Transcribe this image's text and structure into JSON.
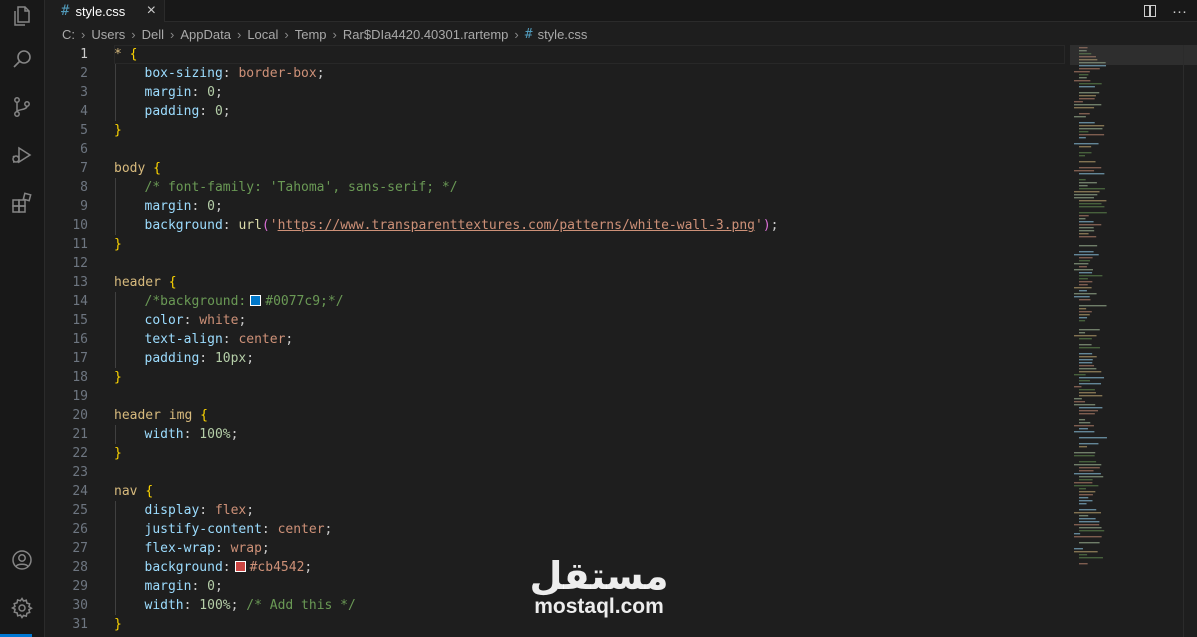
{
  "tab": {
    "label": "style.css",
    "icon": "css-file-icon",
    "close": "×"
  },
  "breadcrumb": {
    "items": [
      "C:",
      "Users",
      "Dell",
      "AppData",
      "Local",
      "Temp",
      "Rar$DIa4420.40301.rartemp",
      "style.css"
    ],
    "separator": "›"
  },
  "editor": {
    "active_line": 1,
    "lines": [
      {
        "n": "1",
        "indent": 0,
        "t": [
          [
            "sel",
            "* "
          ],
          [
            "brace",
            "{"
          ]
        ]
      },
      {
        "n": "2",
        "indent": 1,
        "t": [
          [
            "prop",
            "box-sizing"
          ],
          [
            "punc",
            ": "
          ],
          [
            "val",
            "border-box"
          ],
          [
            "punc",
            ";"
          ]
        ]
      },
      {
        "n": "3",
        "indent": 1,
        "t": [
          [
            "prop",
            "margin"
          ],
          [
            "punc",
            ": "
          ],
          [
            "num",
            "0"
          ],
          [
            "punc",
            ";"
          ]
        ]
      },
      {
        "n": "4",
        "indent": 1,
        "t": [
          [
            "prop",
            "padding"
          ],
          [
            "punc",
            ": "
          ],
          [
            "num",
            "0"
          ],
          [
            "punc",
            ";"
          ]
        ]
      },
      {
        "n": "5",
        "indent": 0,
        "t": [
          [
            "brace",
            "}"
          ]
        ]
      },
      {
        "n": "6",
        "indent": 0,
        "t": []
      },
      {
        "n": "7",
        "indent": 0,
        "t": [
          [
            "sel",
            "body "
          ],
          [
            "brace",
            "{"
          ]
        ]
      },
      {
        "n": "8",
        "indent": 1,
        "t": [
          [
            "comment",
            "/* font-family: 'Tahoma', sans-serif; */"
          ]
        ]
      },
      {
        "n": "9",
        "indent": 1,
        "t": [
          [
            "prop",
            "margin"
          ],
          [
            "punc",
            ": "
          ],
          [
            "num",
            "0"
          ],
          [
            "punc",
            ";"
          ]
        ]
      },
      {
        "n": "10",
        "indent": 1,
        "t": [
          [
            "prop",
            "background"
          ],
          [
            "punc",
            ": "
          ],
          [
            "func",
            "url"
          ],
          [
            "paren",
            "("
          ],
          [
            "val",
            "'"
          ],
          [
            "url",
            "https://www.transparenttextures.com/patterns/white-wall-3.png"
          ],
          [
            "val",
            "'"
          ],
          [
            "paren",
            ")"
          ],
          [
            "punc",
            ";"
          ]
        ]
      },
      {
        "n": "11",
        "indent": 0,
        "t": [
          [
            "brace",
            "}"
          ]
        ]
      },
      {
        "n": "12",
        "indent": 0,
        "t": []
      },
      {
        "n": "13",
        "indent": 0,
        "t": [
          [
            "sel",
            "header "
          ],
          [
            "brace",
            "{"
          ]
        ]
      },
      {
        "n": "14",
        "indent": 1,
        "t": [
          [
            "comment",
            "/*background:"
          ],
          [
            "swatch",
            "#0077c9"
          ],
          [
            "comment",
            "#0077c9;*/"
          ]
        ]
      },
      {
        "n": "15",
        "indent": 1,
        "t": [
          [
            "prop",
            "color"
          ],
          [
            "punc",
            ": "
          ],
          [
            "val",
            "white"
          ],
          [
            "punc",
            ";"
          ]
        ]
      },
      {
        "n": "16",
        "indent": 1,
        "t": [
          [
            "prop",
            "text-align"
          ],
          [
            "punc",
            ": "
          ],
          [
            "val",
            "center"
          ],
          [
            "punc",
            ";"
          ]
        ]
      },
      {
        "n": "17",
        "indent": 1,
        "t": [
          [
            "prop",
            "padding"
          ],
          [
            "punc",
            ": "
          ],
          [
            "num",
            "10px"
          ],
          [
            "punc",
            ";"
          ]
        ]
      },
      {
        "n": "18",
        "indent": 0,
        "t": [
          [
            "brace",
            "}"
          ]
        ]
      },
      {
        "n": "19",
        "indent": 0,
        "t": []
      },
      {
        "n": "20",
        "indent": 0,
        "t": [
          [
            "sel",
            "header img "
          ],
          [
            "brace",
            "{"
          ]
        ]
      },
      {
        "n": "21",
        "indent": 1,
        "t": [
          [
            "prop",
            "width"
          ],
          [
            "punc",
            ": "
          ],
          [
            "num",
            "100%"
          ],
          [
            "punc",
            ";"
          ]
        ]
      },
      {
        "n": "22",
        "indent": 0,
        "t": [
          [
            "brace",
            "}"
          ]
        ]
      },
      {
        "n": "23",
        "indent": 0,
        "t": []
      },
      {
        "n": "24",
        "indent": 0,
        "t": [
          [
            "sel",
            "nav "
          ],
          [
            "brace",
            "{"
          ]
        ]
      },
      {
        "n": "25",
        "indent": 1,
        "t": [
          [
            "prop",
            "display"
          ],
          [
            "punc",
            ": "
          ],
          [
            "val",
            "flex"
          ],
          [
            "punc",
            ";"
          ]
        ]
      },
      {
        "n": "26",
        "indent": 1,
        "t": [
          [
            "prop",
            "justify-content"
          ],
          [
            "punc",
            ": "
          ],
          [
            "val",
            "center"
          ],
          [
            "punc",
            ";"
          ]
        ]
      },
      {
        "n": "27",
        "indent": 1,
        "t": [
          [
            "prop",
            "flex-wrap"
          ],
          [
            "punc",
            ": "
          ],
          [
            "val",
            "wrap"
          ],
          [
            "punc",
            ";"
          ]
        ]
      },
      {
        "n": "28",
        "indent": 1,
        "t": [
          [
            "prop",
            "background"
          ],
          [
            "punc",
            ":"
          ],
          [
            "swatch",
            "#cb4542"
          ],
          [
            "val",
            "#cb4542"
          ],
          [
            "punc",
            ";"
          ]
        ]
      },
      {
        "n": "29",
        "indent": 1,
        "t": [
          [
            "prop",
            "margin"
          ],
          [
            "punc",
            ": "
          ],
          [
            "num",
            "0"
          ],
          [
            "punc",
            ";"
          ]
        ]
      },
      {
        "n": "30",
        "indent": 1,
        "t": [
          [
            "prop",
            "width"
          ],
          [
            "punc",
            ": "
          ],
          [
            "num",
            "100%"
          ],
          [
            "punc",
            "; "
          ],
          [
            "comment",
            "/* Add this */"
          ]
        ]
      },
      {
        "n": "31",
        "indent": 0,
        "t": [
          [
            "brace",
            "}"
          ]
        ]
      }
    ]
  },
  "watermark": {
    "arabic": "مستقل",
    "latin": "mostaql.com"
  },
  "colors": {
    "editor_bg": "#1e1e1e",
    "activity_bar_bg": "#181818",
    "accent": "#0078d4"
  },
  "activity_bar": {
    "top_icons": [
      "explorer-icon",
      "search-icon",
      "source-control-icon",
      "run-debug-icon",
      "extensions-icon"
    ],
    "bottom_icons": [
      "accounts-icon",
      "manage-gear-icon"
    ]
  }
}
